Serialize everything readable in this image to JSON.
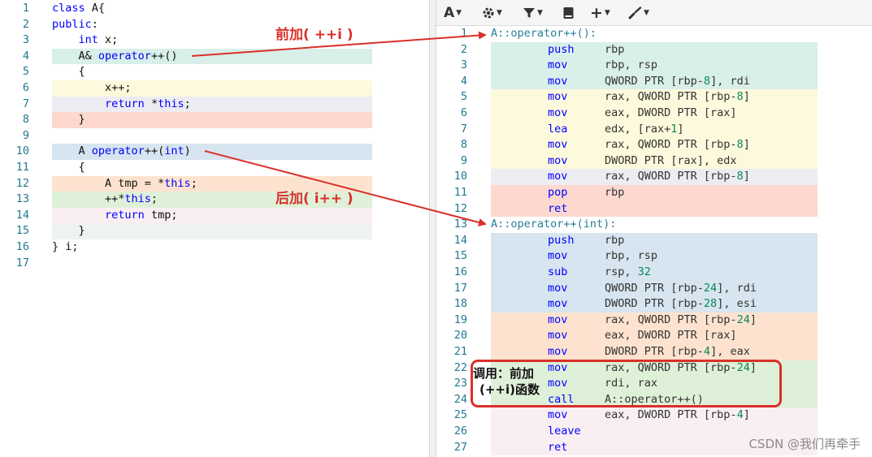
{
  "source": {
    "lines": [
      {
        "n": "1",
        "text": "class A{"
      },
      {
        "n": "2",
        "text": "public:"
      },
      {
        "n": "3",
        "text": "    int x;"
      },
      {
        "n": "4",
        "text": "    A& operator++()"
      },
      {
        "n": "5",
        "text": "    {"
      },
      {
        "n": "6",
        "text": "        x++;"
      },
      {
        "n": "7",
        "text": "        return *this;"
      },
      {
        "n": "8",
        "text": "    }"
      },
      {
        "n": "9",
        "text": ""
      },
      {
        "n": "10",
        "text": "    A operator++(int)"
      },
      {
        "n": "11",
        "text": "    {"
      },
      {
        "n": "12",
        "text": "        A tmp = *this;"
      },
      {
        "n": "13",
        "text": "        ++*this;"
      },
      {
        "n": "14",
        "text": "        return tmp;"
      },
      {
        "n": "15",
        "text": "    }"
      },
      {
        "n": "16",
        "text": "} i;"
      },
      {
        "n": "17",
        "text": ""
      }
    ],
    "highlights": [
      "",
      "",
      "",
      "#d9efe9",
      "#ffffff",
      "#fdf9dc",
      "#ececf2",
      "#fcd8cf",
      "",
      "#d6e5ef",
      "#ffffff",
      "#fde3cf",
      "#dff0d8",
      "#f9eef2",
      "#eef2f0",
      "",
      ""
    ]
  },
  "toolbar": {
    "font_label": "A",
    "icons": [
      "font-icon",
      "gear-icon",
      "filter-icon",
      "book-icon",
      "plus-icon",
      "brush-icon"
    ]
  },
  "asm": {
    "lines": [
      {
        "n": "1",
        "label": "A::operator++():",
        "op": "",
        "args": ""
      },
      {
        "n": "2",
        "label": "",
        "op": "push",
        "args": "rbp"
      },
      {
        "n": "3",
        "label": "",
        "op": "mov",
        "args": "rbp, rsp"
      },
      {
        "n": "4",
        "label": "",
        "op": "mov",
        "args": "QWORD PTR [rbp-8], rdi"
      },
      {
        "n": "5",
        "label": "",
        "op": "mov",
        "args": "rax, QWORD PTR [rbp-8]"
      },
      {
        "n": "6",
        "label": "",
        "op": "mov",
        "args": "eax, DWORD PTR [rax]"
      },
      {
        "n": "7",
        "label": "",
        "op": "lea",
        "args": "edx, [rax+1]"
      },
      {
        "n": "8",
        "label": "",
        "op": "mov",
        "args": "rax, QWORD PTR [rbp-8]"
      },
      {
        "n": "9",
        "label": "",
        "op": "mov",
        "args": "DWORD PTR [rax], edx"
      },
      {
        "n": "10",
        "label": "",
        "op": "mov",
        "args": "rax, QWORD PTR [rbp-8]"
      },
      {
        "n": "11",
        "label": "",
        "op": "pop",
        "args": "rbp"
      },
      {
        "n": "12",
        "label": "",
        "op": "ret",
        "args": ""
      },
      {
        "n": "13",
        "label": "A::operator++(int):",
        "op": "",
        "args": ""
      },
      {
        "n": "14",
        "label": "",
        "op": "push",
        "args": "rbp"
      },
      {
        "n": "15",
        "label": "",
        "op": "mov",
        "args": "rbp, rsp"
      },
      {
        "n": "16",
        "label": "",
        "op": "sub",
        "args": "rsp, 32"
      },
      {
        "n": "17",
        "label": "",
        "op": "mov",
        "args": "QWORD PTR [rbp-24], rdi"
      },
      {
        "n": "18",
        "label": "",
        "op": "mov",
        "args": "DWORD PTR [rbp-28], esi"
      },
      {
        "n": "19",
        "label": "",
        "op": "mov",
        "args": "rax, QWORD PTR [rbp-24]"
      },
      {
        "n": "20",
        "label": "",
        "op": "mov",
        "args": "eax, DWORD PTR [rax]"
      },
      {
        "n": "21",
        "label": "",
        "op": "mov",
        "args": "DWORD PTR [rbp-4], eax"
      },
      {
        "n": "22",
        "label": "",
        "op": "mov",
        "args": "rax, QWORD PTR [rbp-24]"
      },
      {
        "n": "23",
        "label": "",
        "op": "mov",
        "args": "rdi, rax"
      },
      {
        "n": "24",
        "label": "",
        "op": "call",
        "args": "A::operator++()"
      },
      {
        "n": "25",
        "label": "",
        "op": "mov",
        "args": "eax, DWORD PTR [rbp-4]"
      },
      {
        "n": "26",
        "label": "",
        "op": "leave",
        "args": ""
      },
      {
        "n": "27",
        "label": "",
        "op": "ret",
        "args": ""
      }
    ],
    "highlights": [
      "",
      "#d9efe9",
      "#d9efe9",
      "#d9efe9",
      "#fdf9dc",
      "#fdf9dc",
      "#fdf9dc",
      "#fdf9dc",
      "#fdf9dc",
      "#ececf2",
      "#fcd8cf",
      "#fcd8cf",
      "",
      "#d6e5ef",
      "#d6e5ef",
      "#d6e5ef",
      "#d6e5ef",
      "#d6e5ef",
      "#fde3cf",
      "#fde3cf",
      "#fde3cf",
      "#dff0d8",
      "#dff0d8",
      "#dff0d8",
      "#f9eef2",
      "#f9eef2",
      "#f9eef2"
    ]
  },
  "annotations": {
    "prefix_label": "前加( ++i )",
    "postfix_label": "后加( i++ )",
    "call_line1": "调用：前加",
    "call_line2": "(++i)函数",
    "accent": "#d9302a"
  },
  "watermark": "CSDN @我们再牵手"
}
